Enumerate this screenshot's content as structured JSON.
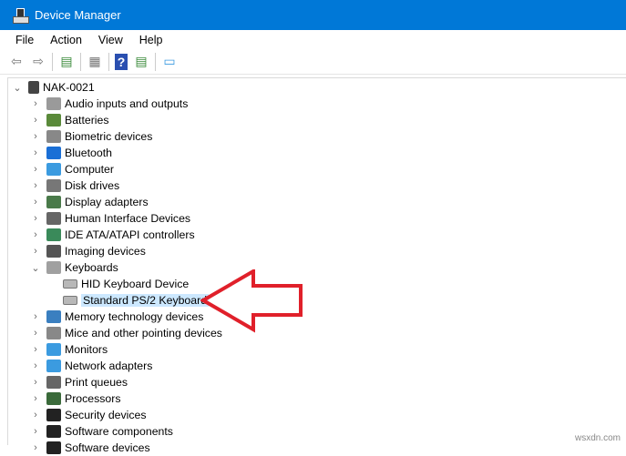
{
  "window": {
    "title": "Device Manager"
  },
  "menu": [
    "File",
    "Action",
    "View",
    "Help"
  ],
  "toolbar": [
    "back-icon",
    "forward-icon",
    "show-hide-console-tree-icon",
    "properties-icon",
    "help-icon",
    "run-action-icon",
    "scan-hardware-icon"
  ],
  "tree": {
    "root": "NAK-0021",
    "categories": [
      {
        "label": "Audio inputs and outputs",
        "color": "#9a9a9a"
      },
      {
        "label": "Batteries",
        "color": "#5a8a3a"
      },
      {
        "label": "Biometric devices",
        "color": "#888888"
      },
      {
        "label": "Bluetooth",
        "color": "#1a6fd6"
      },
      {
        "label": "Computer",
        "color": "#3b9be0"
      },
      {
        "label": "Disk drives",
        "color": "#777777"
      },
      {
        "label": "Display adapters",
        "color": "#4a7a4a"
      },
      {
        "label": "Human Interface Devices",
        "color": "#666666"
      },
      {
        "label": "IDE ATA/ATAPI controllers",
        "color": "#3a8a5a"
      },
      {
        "label": "Imaging devices",
        "color": "#555555"
      },
      {
        "label": "Keyboards",
        "color": "#a0a0a0",
        "expanded": true,
        "children": [
          "HID Keyboard Device",
          "Standard PS/2 Keyboard"
        ]
      },
      {
        "label": "Memory technology devices",
        "color": "#3a7fc0"
      },
      {
        "label": "Mice and other pointing devices",
        "color": "#888888"
      },
      {
        "label": "Monitors",
        "color": "#3b9be0"
      },
      {
        "label": "Network adapters",
        "color": "#3b9be0"
      },
      {
        "label": "Print queues",
        "color": "#666666"
      },
      {
        "label": "Processors",
        "color": "#3a6a3a"
      },
      {
        "label": "Security devices",
        "color": "#222222"
      },
      {
        "label": "Software components",
        "color": "#222222"
      },
      {
        "label": "Software devices",
        "color": "#222222"
      }
    ],
    "selected": "Standard PS/2 Keyboard"
  },
  "annotation_color": "#e0202a",
  "watermark": "wsxdn.com"
}
